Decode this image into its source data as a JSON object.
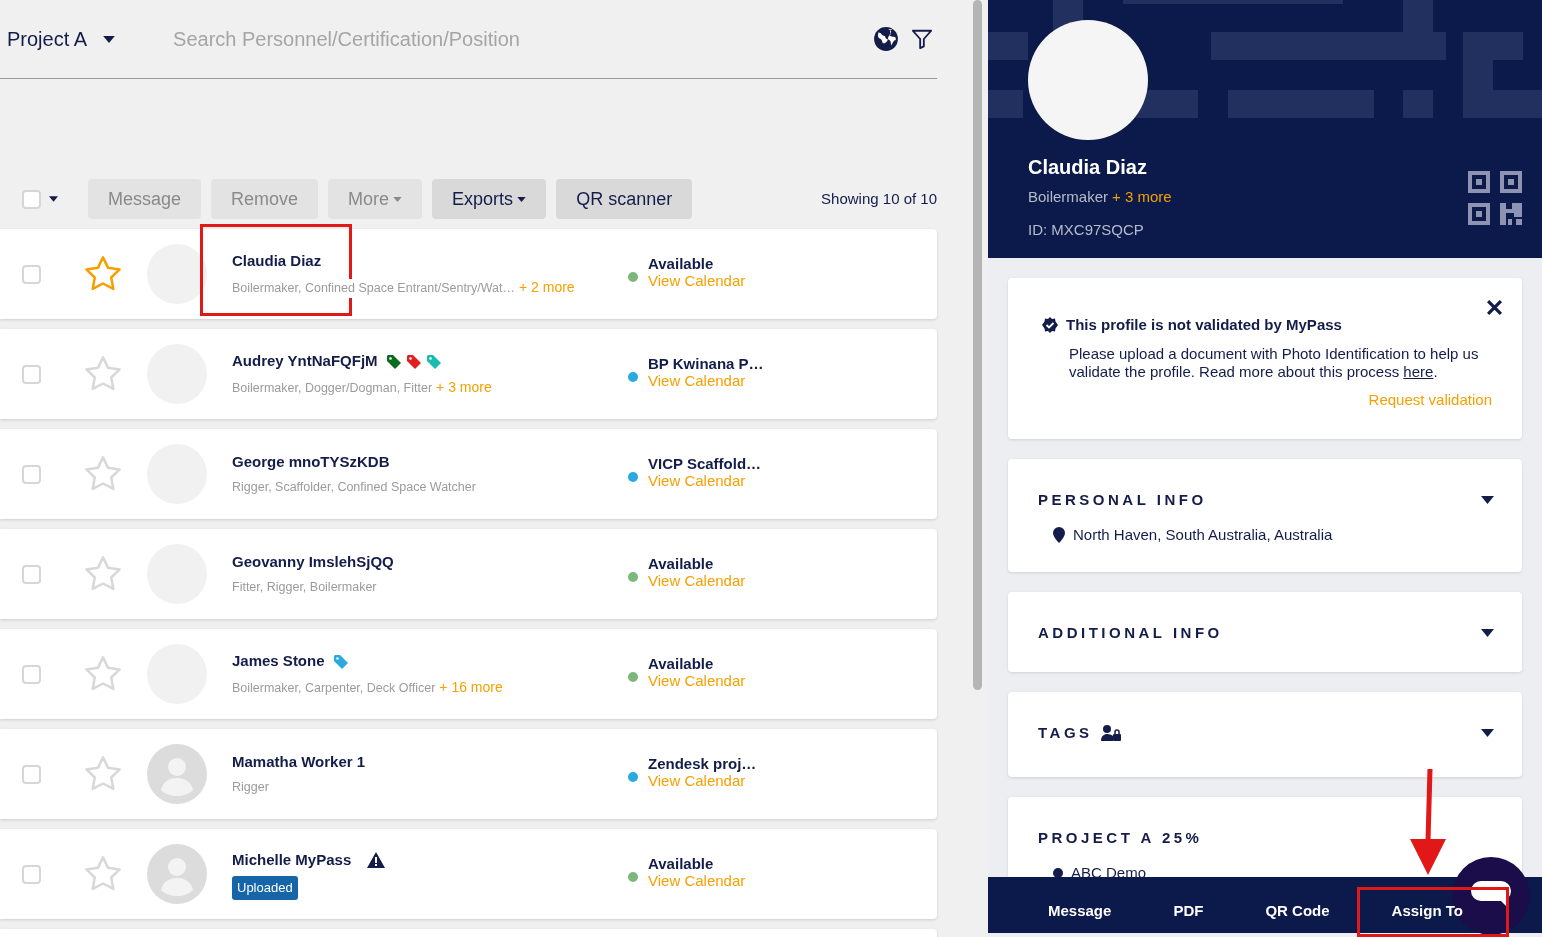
{
  "header": {
    "project": "Project A",
    "search_placeholder": "Search Personnel/Certification/Position"
  },
  "toolbar": {
    "select_all_checked": false,
    "buttons": [
      {
        "label": "Message",
        "disabled": true,
        "dropdown": false
      },
      {
        "label": "Remove",
        "disabled": true,
        "dropdown": false
      },
      {
        "label": "More",
        "disabled": true,
        "dropdown": true
      },
      {
        "label": "Exports",
        "disabled": false,
        "dropdown": true
      },
      {
        "label": "QR scanner",
        "disabled": false,
        "dropdown": false
      }
    ],
    "count": "Showing 10 of 10"
  },
  "rows": [
    {
      "name": "Claudia Diaz",
      "checked": false,
      "favorite": true,
      "kind": "blank",
      "roles": "Boilermaker, Confined Space Entrant/Sentry/Wat…",
      "more": "+ 2 more",
      "tags": [],
      "warning": false,
      "status": "Available",
      "color": "#7cb87a",
      "calendar": "View Calendar"
    },
    {
      "name": "Audrey YntNaFQFjM",
      "checked": false,
      "favorite": false,
      "kind": "blank",
      "roles": "Boilermaker, Dogger/Dogman, Fitter",
      "more": "+ 3 more",
      "tags": [
        {
          "color": "#0a6b1a"
        },
        {
          "color": "#e02020"
        },
        {
          "color": "#1abcb0"
        }
      ],
      "warning": false,
      "status": "BP Kwinana P…",
      "color": "#29a9e0",
      "calendar": "View Calendar"
    },
    {
      "name": "George mnoTYSzKDB",
      "checked": false,
      "favorite": false,
      "kind": "blank",
      "roles": "Rigger, Scaffolder, Confined Space Watcher",
      "tags": [],
      "warning": false,
      "status": "VICP Scaffold…",
      "color": "#29a9e0",
      "calendar": "View Calendar"
    },
    {
      "name": "Geovanny ImslehSjQQ",
      "checked": false,
      "favorite": false,
      "kind": "blank",
      "roles": "Fitter, Rigger, Boilermaker",
      "tags": [],
      "warning": false,
      "status": "Available",
      "color": "#7cb87a",
      "calendar": "View Calendar"
    },
    {
      "name": "James Stone",
      "checked": false,
      "favorite": false,
      "kind": "blank",
      "roles": "Boilermaker, Carpenter, Deck Officer",
      "more": "+ 16 more",
      "tags": [
        {
          "color": "#29a9e0"
        }
      ],
      "warning": false,
      "status": "Available",
      "color": "#7cb87a",
      "calendar": "View Calendar"
    },
    {
      "name": "Mamatha Worker 1",
      "checked": false,
      "favorite": false,
      "kind": "silhouette",
      "roles": "Rigger",
      "tags": [],
      "warning": false,
      "status": "Zendesk proj…",
      "color": "#29a9e0",
      "calendar": "View Calendar"
    },
    {
      "name": "Michelle MyPass",
      "checked": false,
      "favorite": false,
      "kind": "silhouette",
      "badge": "Uploaded",
      "tags": [],
      "warning": true,
      "status": "Available",
      "color": "#7cb87a",
      "calendar": "View Calendar"
    }
  ],
  "profile": {
    "name": "Claudia Diaz",
    "role": "Boilermaker",
    "more": "+ 3 more",
    "id": "ID: MXC97SQCP"
  },
  "alert": {
    "title": "This profile is not validated by MyPass",
    "text": "Please upload a document with Photo Identification to help us validate the profile. Read more about this process",
    "link": "here",
    "after": ".",
    "action": "Request validation"
  },
  "sections": [
    {
      "title": "PERSONAL INFO",
      "lock_icon": false,
      "collapsible": true,
      "items": [
        {
          "kind": "location",
          "text": "North Haven, South Australia, Australia"
        }
      ]
    },
    {
      "title": "ADDITIONAL INFO",
      "lock_icon": false,
      "collapsible": true
    },
    {
      "title": "TAGS",
      "lock_icon": true,
      "collapsible": true
    },
    {
      "title": "PROJECT A 25%",
      "lock_icon": false,
      "collapsible": false,
      "items": [
        {
          "kind": "dot",
          "text": "ABC Demo"
        }
      ]
    }
  ],
  "bottom_bar": [
    "Message",
    "PDF",
    "QR Code",
    "Assign To"
  ]
}
